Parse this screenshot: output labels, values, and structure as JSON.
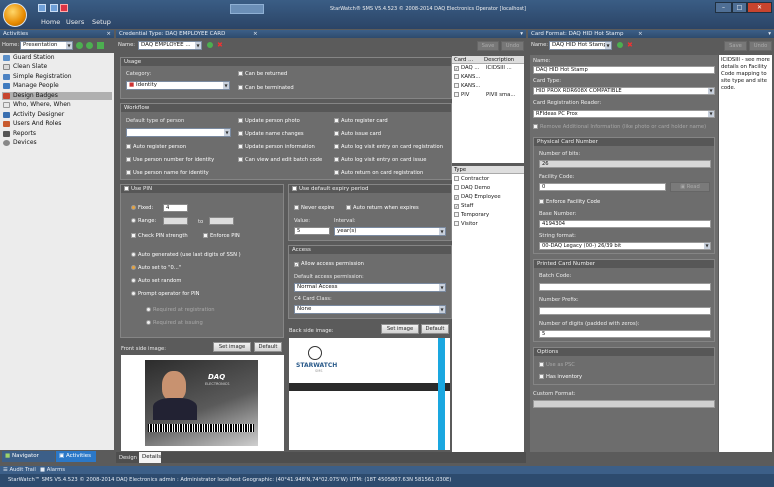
{
  "app": {
    "title": "StarWatch® SMS V5.4.523 © 2008-2014 DAQ Electronics Operator  [localhost]",
    "menu": [
      "Home",
      "Users",
      "Setup"
    ]
  },
  "left_panel": {
    "header": "Activities",
    "home_label": "Home:",
    "home_value": "Presentation",
    "items": [
      "Guard Station",
      "Clean Slate",
      "Simple Registration",
      "Manage People",
      "Design Badges",
      "Who, Where, When",
      "Activity Designer",
      "Users And Roles",
      "Reports",
      "Devices"
    ],
    "bottom_tabs": [
      "Navigator",
      "Activities"
    ]
  },
  "center": {
    "tab_title": "Credential Type: DAQ EMPLOYEE CARD",
    "name_label": "Name:",
    "name_value": "DAQ EMPLOYEE ...",
    "usage": {
      "header": "Usage",
      "category_label": "Category:",
      "category_value": "Identity",
      "can_be_returned": "Can be returned",
      "can_be_terminated": "Can be terminated"
    },
    "workflow": {
      "header": "Workflow",
      "default_type_label": "Default type of person",
      "col2": [
        "Update person photo",
        "Update name changes",
        "Update person information",
        "Can view and edit batch code"
      ],
      "col3": [
        "Auto register card",
        "Auto issue card",
        "Auto log visit entry on card registration",
        "Auto log visit entry on card issue",
        "Auto return on card registration"
      ],
      "col1": [
        "Auto register person",
        "Use person number for identity",
        "Use person name for identity"
      ]
    },
    "pin": {
      "header": "Use PIN",
      "fixed_label": "Fixed:",
      "fixed_value": "4",
      "range_label": "Range:",
      "range_to": "to",
      "check_strength": "Check PIN strength",
      "enforce_pin": "Enforce PIN",
      "auto_generated": "Auto generated (use last digits of SSN )",
      "auto_set": "Auto set to \"0...\"",
      "auto_random": "Auto set random",
      "prompt_operator": "Prompt operator for PIN",
      "required_registration": "Required at registration",
      "required_issuing": "Required at issuing"
    },
    "expiry": {
      "header": "Use default expiry period",
      "never_expire": "Never expire",
      "auto_return_expires": "Auto return when expires",
      "value_label": "Value:",
      "value": "5",
      "interval_label": "Interval:",
      "interval_value": "year(s)"
    },
    "access": {
      "header": "Access",
      "allow_access": "Allow access permission",
      "default_permission_label": "Default access permission:",
      "default_permission_value": "Normal Access",
      "c4_label": "C4 Card Class:",
      "c4_value": "None"
    },
    "front_label": "Front side image:",
    "back_label": "Back side image:",
    "set_image": "Set image",
    "default": "Default",
    "badge_front_brand": "DAQ",
    "badge_front_sub": "ELECTRONICS",
    "badge_back_brand": "STARWATCH",
    "badge_back_sub": "SMS",
    "bottom_tabs": [
      "Design",
      "Details"
    ]
  },
  "card_list": {
    "col1": "Card ...",
    "col2": "Description",
    "rows": [
      {
        "card": "DAQ ...",
        "desc": "ICIDSIII ...",
        "checked": true
      },
      {
        "card": "KANS...",
        "desc": "",
        "checked": false
      },
      {
        "card": "KANS...",
        "desc": "",
        "checked": false
      },
      {
        "card": "PIV",
        "desc": "PIVII sma...",
        "checked": false
      }
    ],
    "type_header": "Type",
    "types": [
      {
        "label": "Contractor",
        "checked": false
      },
      {
        "label": "DAQ Demo",
        "checked": false
      },
      {
        "label": "DAQ Employee",
        "checked": true
      },
      {
        "label": "Staff",
        "checked": true
      },
      {
        "label": "Temporary",
        "checked": false
      },
      {
        "label": "Visitor",
        "checked": false
      }
    ],
    "save": "Save",
    "undo": "Undo"
  },
  "right": {
    "tab_title": "Card Format: DAQ HID Hot Stamp",
    "name_label": "Name:",
    "name_combo": "DAQ HID Hot Stamp",
    "save": "Save",
    "undo": "Undo",
    "name_value": "DAQ HID Hot Stamp",
    "card_type_label": "Card Type:",
    "card_type_value": "HID PROX RDR608X COMPATIBLE",
    "reader_label": "Card Registration Reader:",
    "reader_value": "RFIdeas PC Prox",
    "remove_info": "Remove Additional Information (like photo or card holder name)",
    "physical_header": "Physical Card Number",
    "bits_label": "Number of bits:",
    "bits_value": "26",
    "facility_label": "Facility Code:",
    "facility_value": "0",
    "read": "Read",
    "enforce_facility": "Enforce Facility Code",
    "base_label": "Base Number:",
    "base_value": "4194304",
    "string_format_label": "String format:",
    "string_format_value": "00-DAQ Legacy (00-) 26/39 bit",
    "printed_header": "Printed Card Number",
    "batch_label": "Batch Code:",
    "prefix_label": "Number Prefix:",
    "digits_label": "Number of digits (padded with zeros):",
    "digits_value": "5",
    "options_header": "Options",
    "use_as_psc": "Use as PSC",
    "has_inventory": "Has inventory",
    "custom_format_label": "Custom Format:",
    "note": "ICIDSIII - see more details on Facility Code mapping to site type and site code."
  },
  "footer": {
    "audit": "Audit Trail",
    "alarms": "Alarms",
    "status": "StarWatch™ SMS V5.4.523 © 2008-2014 DAQ Electronics      admin : Administrator      localhost      Geographic: (40°41.948'N,74°02.075'W)   UTM: (18T 4505807.63N 581561.030E)"
  },
  "colors": {
    "titlebar": "#3a5d85",
    "panel_header": "#3c5f88",
    "section_bg": "#6d6d6d",
    "selected_nav": "#b0b0b0",
    "accent_orange": "#e8a33c",
    "badge_blue_bar": "#1aa7e0"
  }
}
